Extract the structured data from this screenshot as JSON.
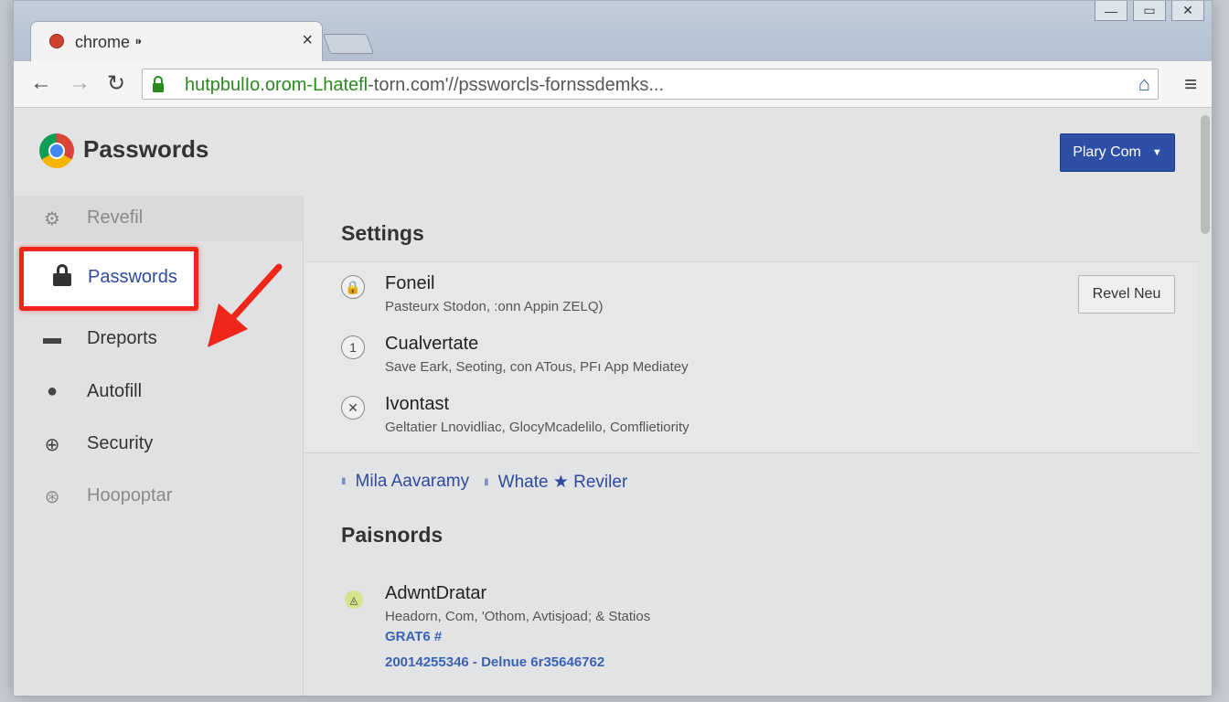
{
  "tab": {
    "title": "chrome ⁍",
    "close": "×"
  },
  "window_controls": {
    "minimize": "—",
    "restore": "▭",
    "close": "✕"
  },
  "toolbar": {
    "back": "←",
    "forward": "→",
    "reload": "↻",
    "url_green": "hutpbulIo.orom-Lhatefl",
    "url_rest": "-torn.com'//pssworcls-fornssdemks...",
    "site_icon": "⌂",
    "menu": "≡"
  },
  "header": {
    "title": "Passwords",
    "play_button": "Plary Com",
    "play_caret": "▼"
  },
  "sidebar": {
    "items": [
      {
        "label": "Revefil",
        "icon": "gear-icon",
        "glyph": "⚙"
      },
      {
        "label": "Passwords",
        "icon": "lock-icon"
      },
      {
        "label": "Dreports",
        "icon": "briefcase-icon",
        "glyph": "▬"
      },
      {
        "label": "Autofill",
        "icon": "lock-icon",
        "glyph": "●"
      },
      {
        "label": "Security",
        "icon": "plus-circle-icon",
        "glyph": "⊕"
      },
      {
        "label": "Hoopoptar",
        "icon": "globe-icon",
        "glyph": "⊛"
      }
    ]
  },
  "settings": {
    "title": "Settings",
    "rows": [
      {
        "title": "Foneil",
        "desc": "Pasteurx Stodon, :onn Appin ZELQ)",
        "glyph": "🔒"
      },
      {
        "title": "Cualvertate",
        "desc": "Save Eark, Seoting, con ATous, PFı App Mediatey",
        "glyph": "1"
      },
      {
        "title": "Ivontast",
        "desc": "Geltatier Lnovidliac, GlocyMcadelilo, Comflietiority",
        "glyph": "✕"
      }
    ],
    "reveal_button": "Revel Neu"
  },
  "links": [
    "Mila Aavaramy",
    "Whate ★ Reviler"
  ],
  "passwords": {
    "title": "Paisnords",
    "entry": {
      "title": "AdwntDratar",
      "desc": "Headorn, Com, 'Othom, Avtisjoad; & Statios",
      "tag": "GRAT6 #",
      "number": "20014255346 - Delnue 6r35646762",
      "glyph": "◬"
    }
  },
  "colors": {
    "highlight_border": "#f0261a",
    "accent_blue": "#2d4fa6",
    "url_green": "#2a8a1e"
  }
}
